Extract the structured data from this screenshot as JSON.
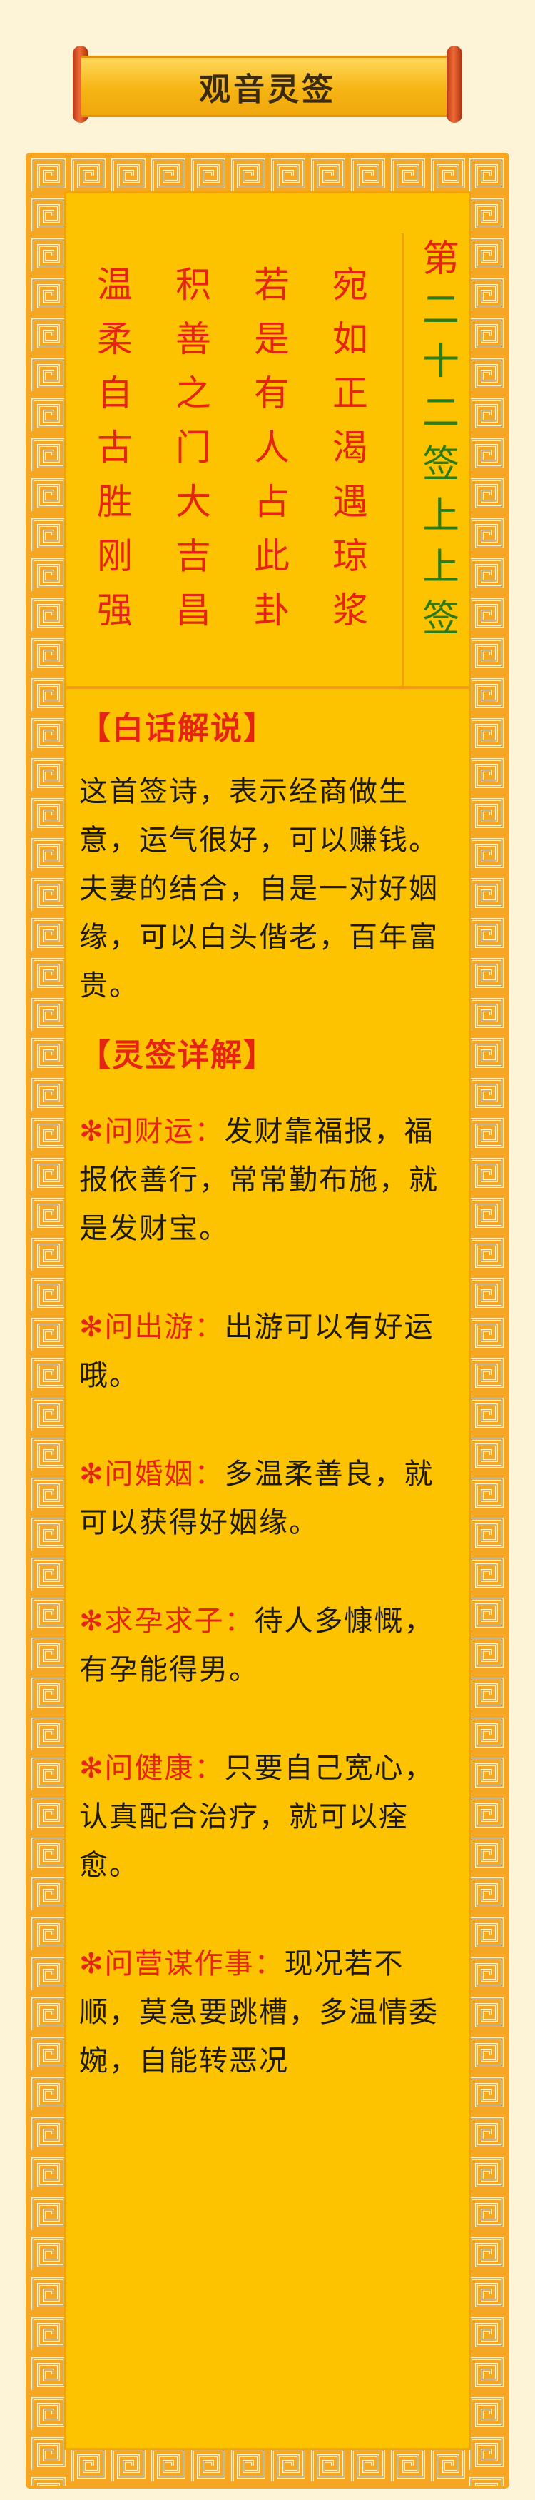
{
  "title": "观音灵签",
  "poem": {
    "columns": [
      [
        "宛",
        "如",
        "正",
        "渴",
        "遇",
        "琼",
        "浆"
      ],
      [
        "若",
        "是",
        "有",
        "人",
        "占",
        "此",
        "卦"
      ],
      [
        "积",
        "善",
        "之",
        "门",
        "大",
        "吉",
        "昌"
      ],
      [
        "温",
        "柔",
        "自",
        "古",
        "胜",
        "刚",
        "强"
      ]
    ],
    "sign_chars": [
      "第",
      "二",
      "十",
      "二",
      "签",
      "上",
      "上",
      "签"
    ]
  },
  "plain_explanation": {
    "heading": "【白话解说】",
    "text": "这首签诗，表示经商做生意，运气很好，可以赚钱。夫妻的结合，自是一对好姻缘，可以白头偕老，百年富贵。"
  },
  "detail": {
    "heading": "【灵签详解】",
    "mark": "✻",
    "items": [
      {
        "q": "问财运：",
        "a": "发财靠福报，福报依善行，常常勤布施，就是发财宝。"
      },
      {
        "q": "问出游：",
        "a": "出游可以有好运哦。"
      },
      {
        "q": "问婚姻：",
        "a": "多温柔善良，就可以获得好姻缘。"
      },
      {
        "q": "求孕求子：",
        "a": "待人多慷慨，有孕能得男。"
      },
      {
        "q": "问健康：",
        "a": "只要自己宽心，认真配合治疗，就可以痊愈。"
      },
      {
        "q": "问营谋作事：",
        "a": "现况若不顺，莫急要跳槽，多温情委婉，自能转恶况"
      }
    ]
  },
  "colors": {
    "background": "#fdf3d6",
    "frame": "#f5a623",
    "panel": "#fdc300",
    "poem_red": "#e52412",
    "sign_green": "#2b7b17",
    "text": "#1f1a10"
  }
}
